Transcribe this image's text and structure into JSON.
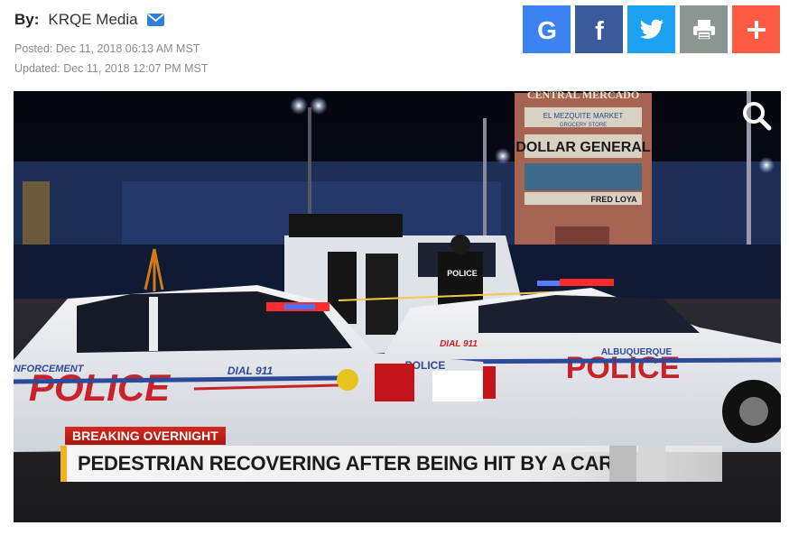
{
  "byline": {
    "label": "By:",
    "author": "KRQE Media",
    "icon": "envelope-icon"
  },
  "dates": {
    "posted": "Posted: Dec 11, 2018 06:13 AM MST",
    "updated": "Updated: Dec 11, 2018 12:07 PM MST"
  },
  "share": [
    {
      "name": "google",
      "icon": "google-icon",
      "color": "#3c82f0"
    },
    {
      "name": "facebook",
      "icon": "facebook-icon",
      "color": "#3a5a99"
    },
    {
      "name": "twitter",
      "icon": "twitter-icon",
      "color": "#1da1f2"
    },
    {
      "name": "print",
      "icon": "print-icon",
      "color": "#8c9691"
    },
    {
      "name": "more",
      "icon": "plus-icon",
      "color": "#ff5a42"
    }
  ],
  "photo": {
    "signs": {
      "top": "CENTRAL MERCADO",
      "market": "EL MEZQUITE MARKET",
      "grocery": "GROCERY STORE",
      "dollar": "DOLLAR GENERAL",
      "fred": "FRED LOYA"
    },
    "car_left": {
      "text": "POLICE",
      "dial": "DIAL 911",
      "enforcement": "ENFORCEMENT",
      "door_police": "POLICE"
    },
    "car_right": {
      "text": "POLICE",
      "dial": "DIAL 911",
      "city": "ALBUQUERQUE"
    },
    "officer_vest": "POLICE"
  },
  "chyron": {
    "label": "BREAKING OVERNIGHT",
    "headline": "PEDESTRIAN RECOVERING AFTER BEING HIT BY A CAR"
  },
  "colors": {
    "accent_red": "#d42a1f",
    "accent_yellow": "#f3b21a"
  }
}
